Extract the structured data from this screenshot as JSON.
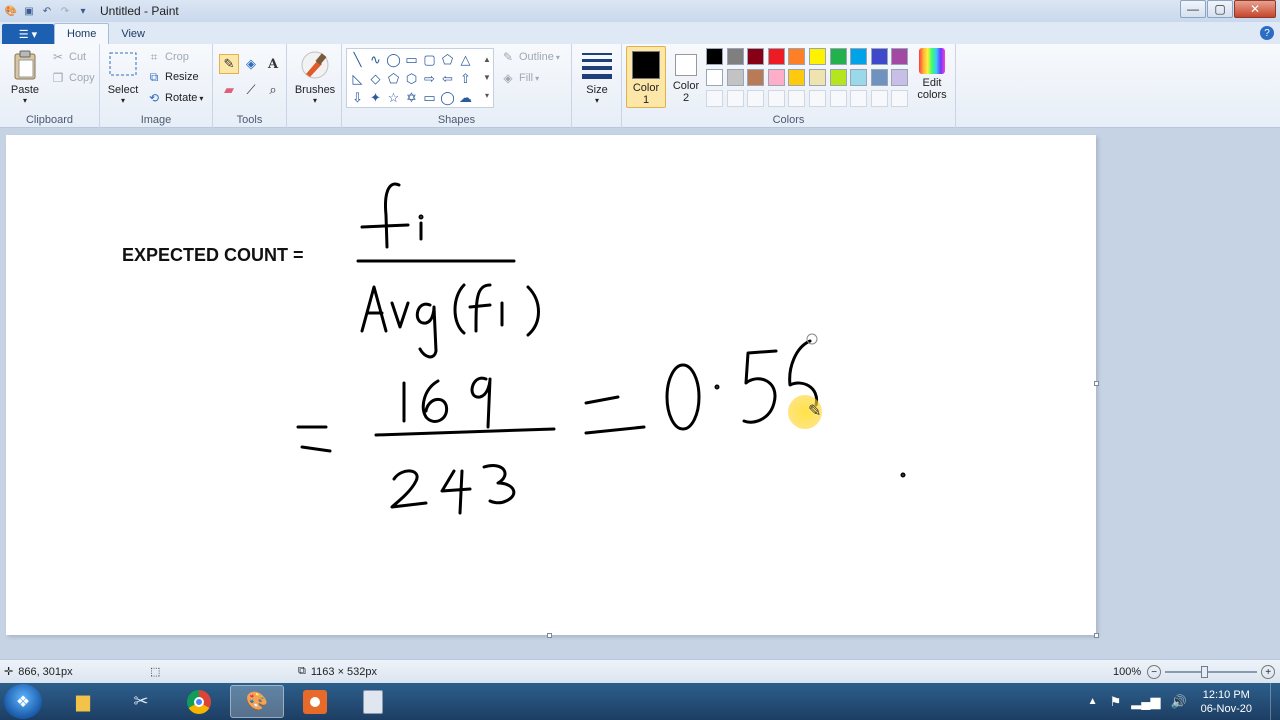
{
  "window": {
    "title": "Untitled - Paint"
  },
  "tabs": {
    "file": "",
    "home": "Home",
    "view": "View"
  },
  "clipboard": {
    "paste": "Paste",
    "cut": "Cut",
    "copy": "Copy",
    "label": "Clipboard"
  },
  "image": {
    "select": "Select",
    "crop": "Crop",
    "resize": "Resize",
    "rotate": "Rotate",
    "label": "Image"
  },
  "tools": {
    "label": "Tools"
  },
  "brushes": {
    "label": "Brushes"
  },
  "shapes": {
    "outline": "Outline",
    "fill": "Fill",
    "label": "Shapes"
  },
  "size": {
    "label": "Size"
  },
  "colors": {
    "color1": "Color\n1",
    "color1_line1": "Color",
    "color1_line2": "1",
    "color2_line1": "Color",
    "color2_line2": "2",
    "edit_line1": "Edit",
    "edit_line2": "colors",
    "label": "Colors",
    "color1_value": "#000000",
    "color2_value": "#ffffff",
    "palette_row1": [
      "#000000",
      "#7f7f7f",
      "#880015",
      "#ed1c24",
      "#ff7f27",
      "#fff200",
      "#22b14c",
      "#00a2e8",
      "#3f48cc",
      "#a349a4"
    ],
    "palette_row2": [
      "#ffffff",
      "#c3c3c3",
      "#b97a57",
      "#ffaec9",
      "#ffc90e",
      "#efe4b0",
      "#b5e61d",
      "#99d9ea",
      "#7092be",
      "#c8bfe7"
    ]
  },
  "canvas": {
    "expected_label": "EXPECTED COUNT ="
  },
  "status": {
    "cursor_pos": "866, 301px",
    "image_size": "1163 × 532px",
    "zoom": "100%"
  },
  "taskbar": {
    "time": "12:10 PM",
    "date": "06-Nov-20"
  }
}
